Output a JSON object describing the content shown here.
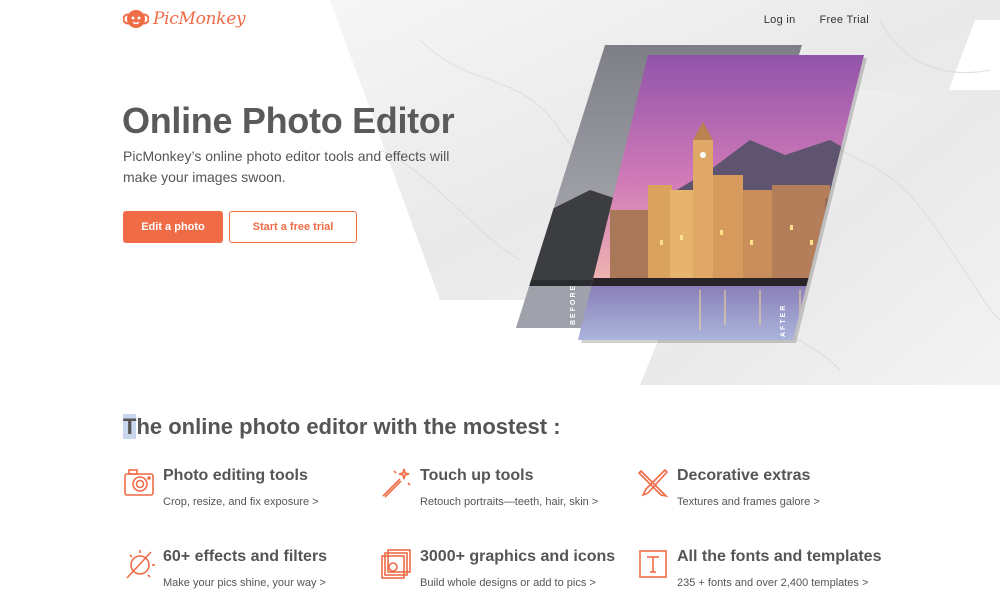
{
  "header": {
    "logo_text": "PicMonkey",
    "nav": {
      "login": "Log in",
      "free_trial": "Free Trial"
    }
  },
  "hero": {
    "title": "Online Photo Editor",
    "subtitle": "PicMonkey’s online photo editor tools and effects will make your images swoon.",
    "primary_button": "Edit a photo",
    "secondary_button": "Start a free trial",
    "image_labels": {
      "before": "BEFORE",
      "after": "AFTER"
    }
  },
  "features_section": {
    "title_first_letter": "T",
    "title_rest": "he online photo editor with the mostest :",
    "items": [
      {
        "icon": "camera-icon",
        "title": "Photo editing tools",
        "desc": "Crop, resize, and fix exposure >"
      },
      {
        "icon": "magic-wand-icon",
        "title": "Touch up tools",
        "desc": "Retouch portraits—teeth, hair, skin >"
      },
      {
        "icon": "brush-pencil-icon",
        "title": "Decorative extras",
        "desc": "Textures and frames galore >"
      },
      {
        "icon": "effects-icon",
        "title": "60+ effects and filters",
        "desc": "Make your pics shine, your way >"
      },
      {
        "icon": "graphics-stack-icon",
        "title": "3000+ graphics and icons",
        "desc": "Build whole designs or add to pics >"
      },
      {
        "icon": "text-frame-icon",
        "title": "All the fonts and templates",
        "desc": "235 + fonts and over 2,400 templates >"
      }
    ]
  },
  "colors": {
    "accent": "#ef6c47",
    "text": "#555555",
    "marble": "#eeeeee"
  }
}
